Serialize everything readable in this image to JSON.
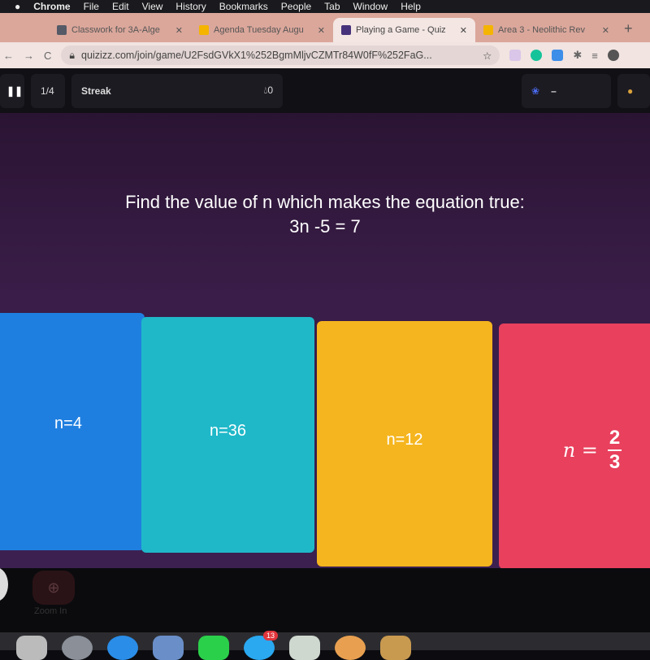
{
  "menubar": {
    "items": [
      "Chrome",
      "File",
      "Edit",
      "View",
      "History",
      "Bookmarks",
      "People",
      "Tab",
      "Window",
      "Help"
    ]
  },
  "tabs": [
    {
      "title": "Classwork for 3A-Alge",
      "icon": "classroom-icon",
      "color": "#555a66",
      "active": false
    },
    {
      "title": "Agenda Tuesday Augu",
      "icon": "slides-icon",
      "color": "#f4b400",
      "active": false
    },
    {
      "title": "Playing a Game - Quiz",
      "icon": "quizizz-icon",
      "color": "#46327a",
      "active": true
    },
    {
      "title": "Area 3 - Neolithic Rev",
      "icon": "slides-icon",
      "color": "#f4b400",
      "active": false
    }
  ],
  "address": {
    "url": "quizizz.com/join/game/U2FsdGVkX1%252BgmMljvCZMTr84W0fF%252FaG..."
  },
  "quiz": {
    "progress": "1/4",
    "streak_label": "Streak",
    "streak_value": "0",
    "medal_value": "–",
    "question_line1": "Find the value of n which makes the equation true:",
    "question_line2": "3n -5 = 7",
    "options": [
      {
        "label": "n=4",
        "color": "#1f7fe0"
      },
      {
        "label": "n=36",
        "color": "#1fb8c9"
      },
      {
        "label": "n=12",
        "color": "#f5b51e"
      },
      {
        "label": "n =",
        "numerator": "2",
        "denominator": "3",
        "color": "#e8405d"
      }
    ]
  },
  "bottom": {
    "zoom_label": "Zoom In",
    "dock_badge": "13"
  }
}
